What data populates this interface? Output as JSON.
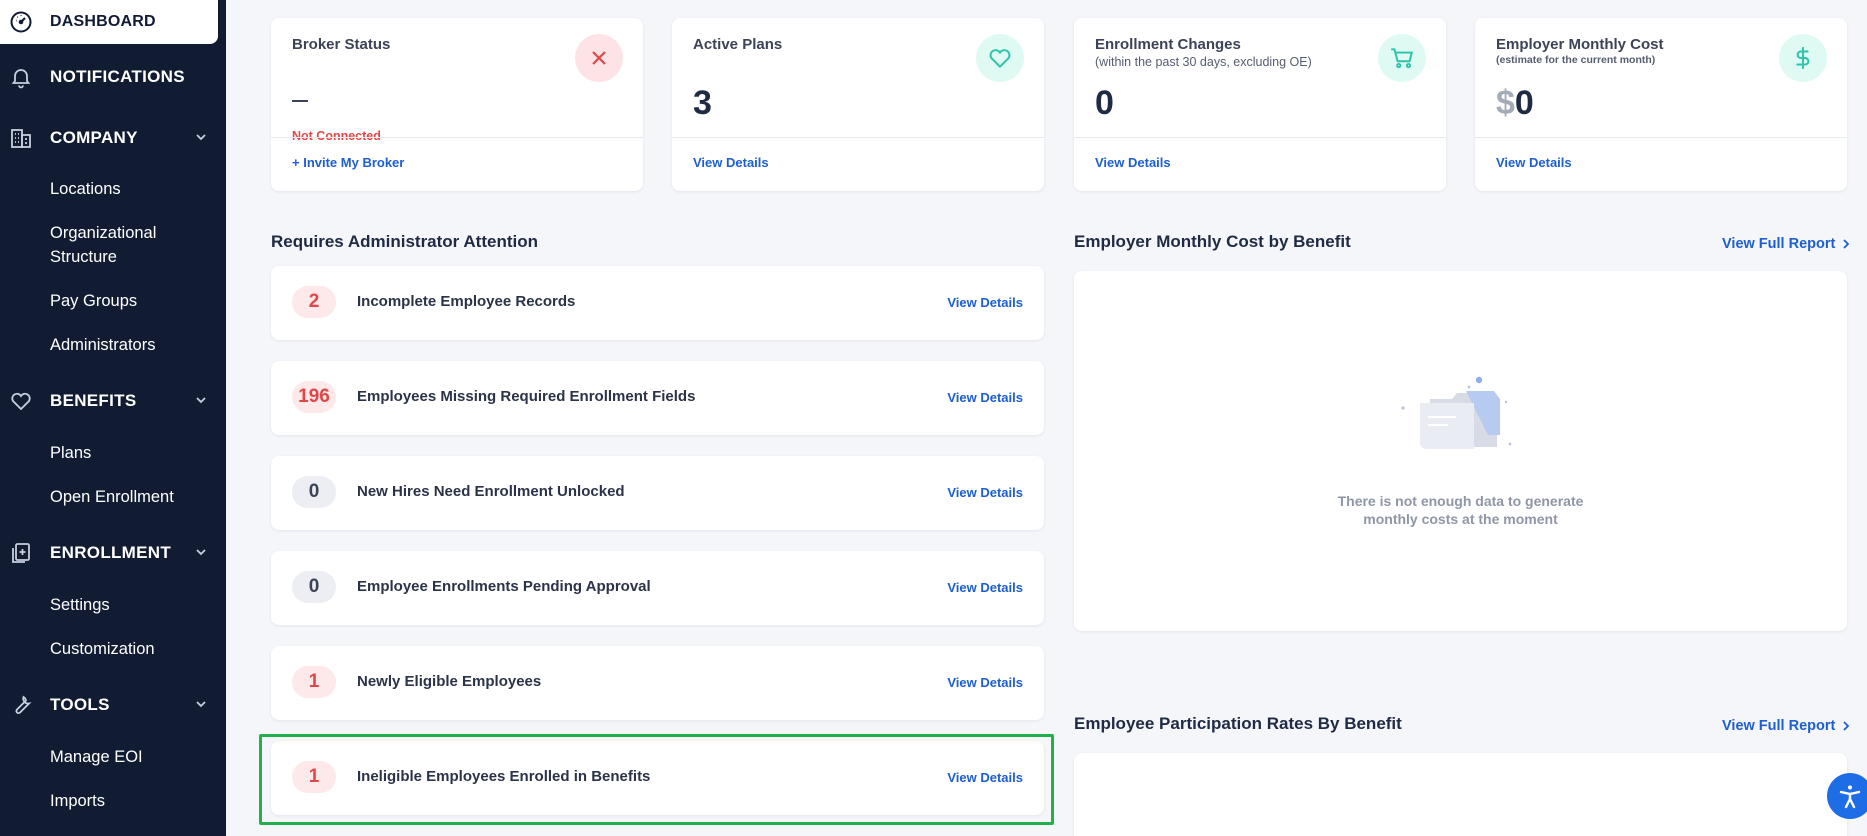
{
  "sidebar": {
    "dashboard": "DASHBOARD",
    "notifications": "NOTIFICATIONS",
    "company": {
      "label": "COMPANY",
      "items": [
        "Locations",
        "Organizational",
        "Structure",
        "Pay Groups",
        "Administrators"
      ]
    },
    "benefits": {
      "label": "BENEFITS",
      "items": [
        "Plans",
        "Open Enrollment"
      ]
    },
    "enrollment": {
      "label": "ENROLLMENT",
      "items": [
        "Settings",
        "Customization"
      ]
    },
    "tools": {
      "label": "TOOLS",
      "items": [
        "Manage EOI",
        "Imports"
      ]
    }
  },
  "stats": [
    {
      "title": "Broker Status",
      "status": "Not Connected",
      "link": "+ Invite My Broker",
      "icon": "x-icon",
      "color": "#e04848"
    },
    {
      "title": "Active Plans",
      "value": "3",
      "link": "View Details",
      "icon": "heart-icon",
      "color": "#2cc3a8"
    },
    {
      "title": "Enrollment Changes",
      "subtitle": "(within the past 30 days, excluding OE)",
      "value": "0",
      "link": "View Details",
      "icon": "cart-icon",
      "color": "#2cc3a8"
    },
    {
      "title": "Employer Monthly Cost",
      "subtitle": "(estimate for the current month)",
      "currency": "$",
      "value": "0",
      "link": "View Details",
      "icon": "dollar-icon",
      "color": "#2cc3a8"
    }
  ],
  "attention": {
    "title": "Requires Administrator Attention",
    "rows": [
      {
        "count": "2",
        "label": "Incomplete Employee Records",
        "link": "View Details",
        "tone": "red"
      },
      {
        "count": "196",
        "label": "Employees Missing Required Enrollment Fields",
        "link": "View Details",
        "tone": "red"
      },
      {
        "count": "0",
        "label": "New Hires Need Enrollment Unlocked",
        "link": "View Details",
        "tone": "gray"
      },
      {
        "count": "0",
        "label": "Employee Enrollments Pending Approval",
        "link": "View Details",
        "tone": "gray"
      },
      {
        "count": "1",
        "label": "Newly Eligible Employees",
        "link": "View Details",
        "tone": "red"
      },
      {
        "count": "1",
        "label": "Ineligible Employees Enrolled in Benefits",
        "link": "View Details",
        "tone": "red"
      }
    ]
  },
  "cost_by_benefit": {
    "title": "Employer Monthly Cost by Benefit",
    "link": "View Full Report",
    "empty_line1": "There is not enough data to generate",
    "empty_line2": "monthly costs at the moment"
  },
  "participation": {
    "title": "Employee Participation Rates By Benefit",
    "link": "View Full Report"
  },
  "colors": {
    "sidebar_bg": "#111c33",
    "link_blue": "#1d5fd1",
    "alert_red": "#e04848",
    "accent_teal": "#2cc3a8",
    "highlight_green": "#22b04b"
  }
}
